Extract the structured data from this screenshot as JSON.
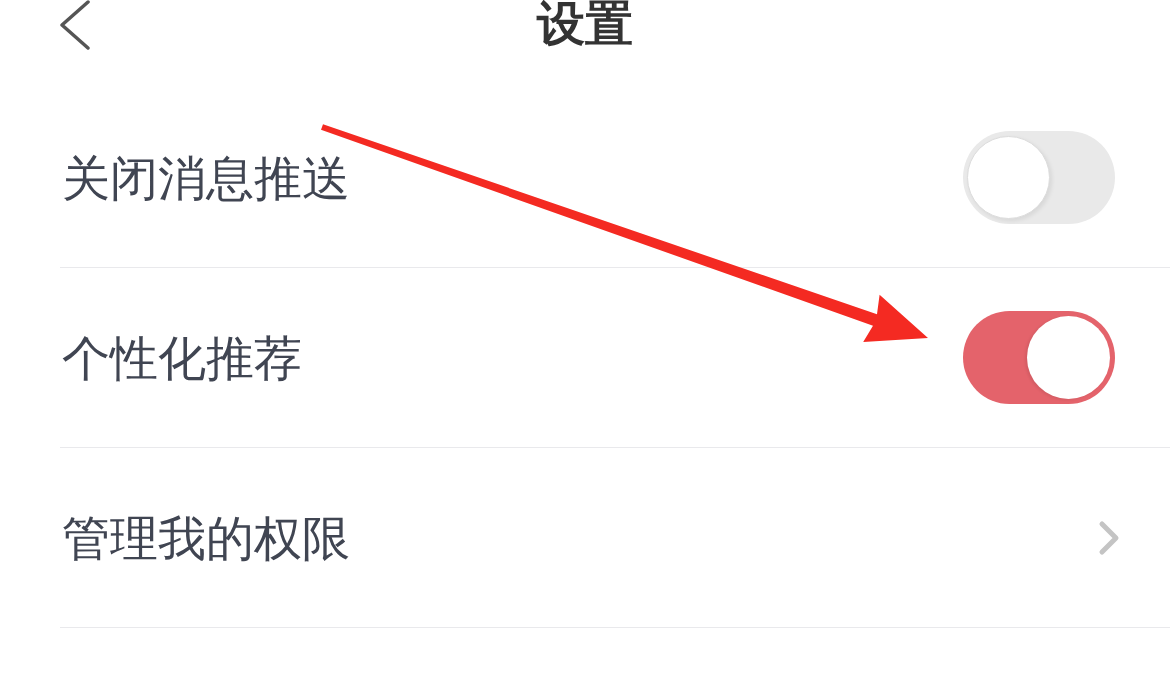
{
  "header": {
    "title": "设置"
  },
  "settings": [
    {
      "kind": "toggle",
      "label": "关闭消息推送",
      "on": false
    },
    {
      "kind": "toggle",
      "label": "个性化推荐",
      "on": true
    },
    {
      "kind": "link",
      "label": "管理我的权限"
    }
  ]
}
